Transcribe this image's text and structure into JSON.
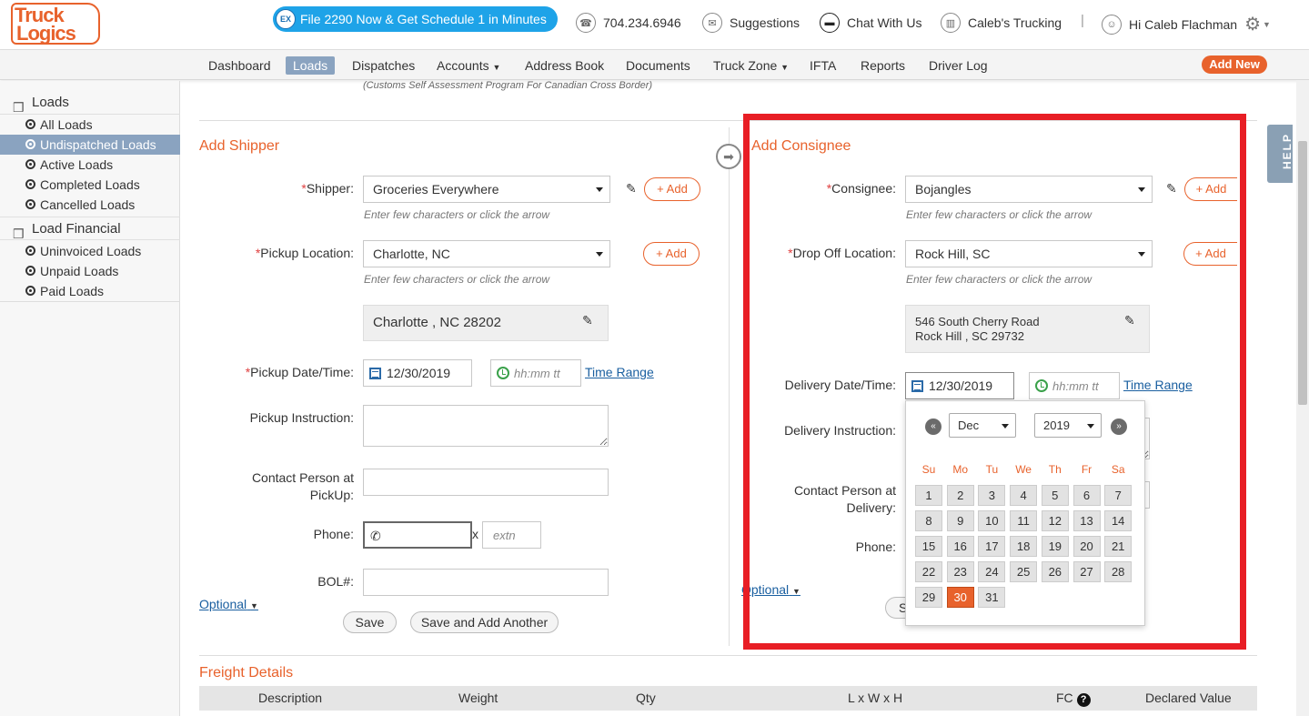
{
  "header": {
    "logo_line1": "Truck",
    "logo_line2": "Logics",
    "promo_badge": "EX",
    "promo": "File 2290 Now & Get Schedule 1 in Minutes",
    "phone": "704.234.6946",
    "suggestions": "Suggestions",
    "chat": "Chat With Us",
    "company": "Caleb's Trucking",
    "separator": "|",
    "greeting": "Hi Caleb Flachman"
  },
  "nav": {
    "items": [
      "Dashboard",
      "Loads",
      "Dispatches",
      "Accounts",
      "Address Book",
      "Documents",
      "Truck Zone",
      "IFTA",
      "Reports",
      "Driver Log"
    ],
    "add_new": "Add New"
  },
  "sidebar": {
    "group1": "Loads",
    "items1": [
      "All Loads",
      "Undispatched Loads",
      "Active Loads",
      "Completed Loads",
      "Cancelled Loads"
    ],
    "group2": "Load Financial",
    "items2": [
      "Uninvoiced Loads",
      "Unpaid Loads",
      "Paid Loads"
    ]
  },
  "note": "(Customs Self Assessment Program For Canadian Cross Border)",
  "shipper": {
    "title": "Add Shipper",
    "shipper_label": "Shipper:",
    "shipper_value": "Groceries Everywhere",
    "hint": "Enter few characters or click the arrow",
    "add": "Add",
    "pickup_loc_label": "Pickup Location:",
    "pickup_loc_value": "Charlotte, NC",
    "address": "Charlotte , NC 28202",
    "pickup_dt_label": "Pickup Date/Time:",
    "date": "12/30/2019",
    "time_placeholder": "hh:mm tt",
    "time_range": "Time Range",
    "instruction_label": "Pickup Instruction:",
    "contact_label_1": "Contact Person at",
    "contact_label_2": "PickUp:",
    "phone_label": "Phone:",
    "x": "x",
    "extn_placeholder": "extn",
    "bol_label": "BOL#:",
    "optional": "Optional",
    "save": "Save",
    "save_add": "Save and Add Another"
  },
  "consignee": {
    "title": "Add Consignee",
    "consignee_label": "Consignee:",
    "consignee_value": "Bojangles",
    "hint": "Enter few characters or click the arrow",
    "add": "Add",
    "drop_label": "Drop Off Location:",
    "drop_value": "Rock Hill, SC",
    "address_line1": "546 South Cherry Road",
    "address_line2": "Rock Hill , SC 29732",
    "delivery_dt_label": "Delivery Date/Time:",
    "date": "12/30/2019",
    "time_placeholder": "hh:mm tt",
    "time_range": "Time Range",
    "instruction_label": "Delivery Instruction:",
    "contact_label_1": "Contact Person at",
    "contact_label_2": "Delivery:",
    "phone_label": "Phone:",
    "optional": "Optional",
    "save_partial": "S"
  },
  "datepicker": {
    "month": "Dec",
    "year": "2019",
    "weekdays": [
      "Su",
      "Mo",
      "Tu",
      "We",
      "Th",
      "Fr",
      "Sa"
    ],
    "selected_day": 30,
    "first_weekday": 0,
    "days_in_month": 31
  },
  "freight": {
    "title": "Freight Details",
    "columns": [
      "Description",
      "Weight",
      "Qty",
      "L x W x H",
      "FC",
      "Declared Value"
    ]
  },
  "help": "HELP",
  "colors": {
    "accent": "#e8622c",
    "highlight_frame": "#e81e25",
    "nav_active": "#8aa3c0",
    "promo": "#1ea3e8"
  }
}
